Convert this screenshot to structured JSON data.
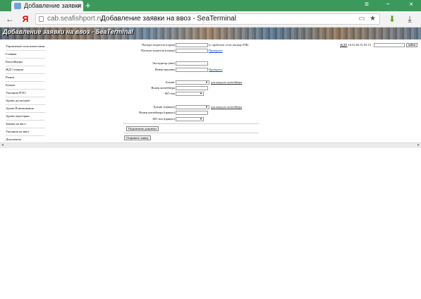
{
  "browser": {
    "tab_title": "Добавление заявки на",
    "tab_close": "×",
    "new_tab": "+",
    "window_controls": {
      "menu": "≡",
      "minimize": "−",
      "close": "×"
    },
    "back_icon": "←",
    "home_icon": "Я",
    "url": "cab.seafishport.ru",
    "page_title": "Добавление заявки на ввоз - SeaTerminal",
    "bookmarks_icon": "▭",
    "star_icon": "★",
    "download_arrow_icon": "⬇",
    "downloads_icon": "⤓",
    "colors": {
      "tabbar": "#3b9a5b",
      "toolbar": "#f2f2f2"
    }
  },
  "header": {
    "title": "Добавление заявки на ввоз - SeaTerminal"
  },
  "sidebar": {
    "items": [
      "Управление пользователями",
      "Главная",
      "Контейнеры",
      "ЖД Станция",
      "Рынок",
      "Букинг",
      "Указания ВЭО",
      "Архив досмотров",
      "Архив Взвешивания",
      "Архив перетарки",
      "Заявки на ввоз",
      "Указания на ввоз",
      "Документы"
    ]
  },
  "top_right": {
    "label_link": "ЖДП",
    "date_text": "16.52.02.31.03.15",
    "search_button": "найти"
  },
  "form": {
    "passport_series_label": "Паспорт водителя (серия)",
    "passport_note": "(с пробелом, если паспорт РФ)",
    "passport_number_label": "Паспорт водителя (номер)",
    "check_link_1": "Проверить",
    "forwarder_inn_label": "Экспедитор (инн)",
    "machine_number_label": "Номер машины",
    "check_link_2": "Проверить",
    "booking_label": "Букинг",
    "booking_link": "для каждого контейнера",
    "container_number_label": "Номер контейнера",
    "iso_type_label": "ISO тип",
    "booking_trailer_label": "Букинг (прицеп)",
    "booking_trailer_link": "для каждого контейнера",
    "container_trailer_label": "Номер контейнера (прицеп)",
    "iso_trailer_label": "ISO тип (прицеп)",
    "attach_button": "Подключить документ",
    "submit_button": "Отправить заявку"
  },
  "scrollbar": {
    "left_arrow": "◂",
    "right_arrow": "▸"
  }
}
